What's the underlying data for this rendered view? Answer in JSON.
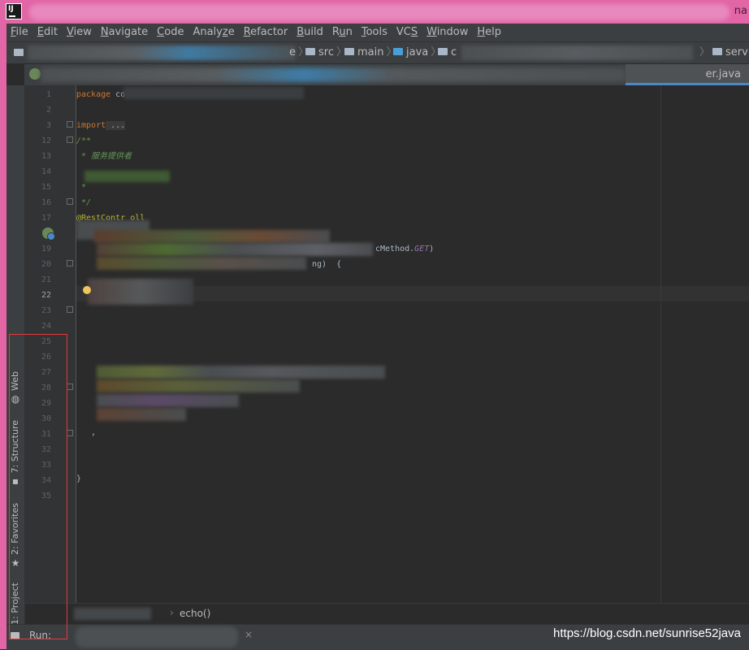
{
  "titlebar": {
    "tail_text": "na"
  },
  "menu": [
    "File",
    "Edit",
    "View",
    "Navigate",
    "Code",
    "Analyze",
    "Refactor",
    "Build",
    "Run",
    "Tools",
    "VCS",
    "Window",
    "Help"
  ],
  "menu_mnemonics": [
    "F",
    "E",
    "V",
    "N",
    "C",
    "z",
    "R",
    "B",
    "u",
    "T",
    "S",
    "W",
    "H"
  ],
  "navbar": {
    "crumb_e": "e",
    "src": "src",
    "main": "main",
    "java": "java",
    "c": "c",
    "service": "service"
  },
  "tab": {
    "label": "er.java"
  },
  "sidebar": {
    "web": "Web",
    "structure": "7: Structure",
    "favorites": "2: Favorites",
    "project": "1: Project"
  },
  "gutter": {
    "line_numbers": [
      "1",
      "2",
      "3",
      "12",
      "13",
      "14",
      "15",
      "16",
      "17",
      "18",
      "19",
      "20",
      "21",
      "22",
      "23",
      "24",
      "25",
      "26",
      "27",
      "28",
      "29",
      "30",
      "31",
      "32",
      "33",
      "34",
      "35"
    ],
    "current_line": "22"
  },
  "code": {
    "l1_kw": "package",
    "l1_rest": " co",
    "l3_kw": "import",
    "l3_rest": " ...",
    "l12": "/**",
    "l13": " * 服务提供者",
    "l15": " *",
    "l16": " */",
    "l17": "@RestContr oll",
    "l19_plain": "cMethod.",
    "l19_const": "GET",
    "l19_end": ")",
    "l20": "ng)  {",
    "l31": "   ,",
    "l34": "}"
  },
  "breadcrumb": {
    "method": "echo()"
  },
  "runbar": {
    "label": "Run:",
    "close": "×"
  },
  "watermark": "https://blog.csdn.net/sunrise52java",
  "colors": {
    "title_bar": "#e265a6",
    "editor_bg": "#2b2b2b",
    "annotation_box": "#e8373b"
  }
}
